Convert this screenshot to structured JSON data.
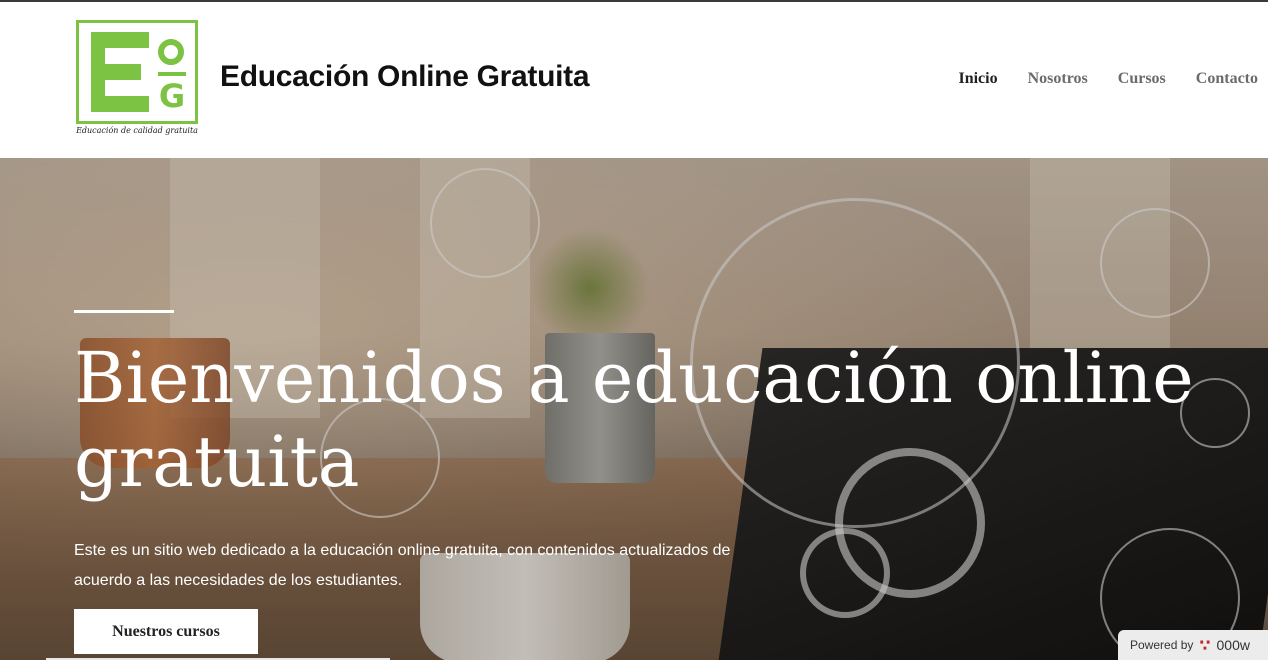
{
  "header": {
    "logo_icon": "eog-logo",
    "logo_letters": {
      "e": "E",
      "o": "O",
      "g": "G"
    },
    "logo_tagline": "Educación de calidad gratuita",
    "site_title": "Educación Online Gratuita",
    "nav": [
      {
        "label": "Inicio",
        "active": true
      },
      {
        "label": "Nosotros",
        "active": false
      },
      {
        "label": "Cursos",
        "active": false
      },
      {
        "label": "Contacto",
        "active": false
      }
    ]
  },
  "hero": {
    "title": "Bienvenidos a educación online gratuita",
    "description": "Este es un sitio web dedicado a la educación online gratuita, con contenidos actualizados de acuerdo a las necesidades de los estudiantes.",
    "button_label": "Nuestros cursos"
  },
  "powered_by": {
    "label": "Powered by",
    "brand": "000w",
    "icon": "000webhost-logo-icon"
  },
  "colors": {
    "brand_green": "#7cc243",
    "nav_active": "#222222",
    "nav_inactive": "#6b6b6b"
  }
}
